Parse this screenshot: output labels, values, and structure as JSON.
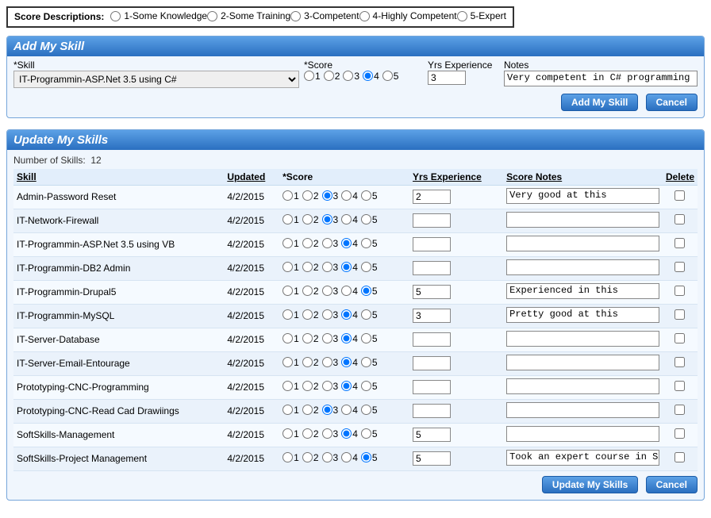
{
  "score_descriptions": {
    "label": "Score Descriptions:",
    "options": [
      "1-Some Knowledge",
      "2-Some Training",
      "3-Competent",
      "4-Highly Competent",
      "5-Expert"
    ]
  },
  "add_panel": {
    "title": "Add My Skill",
    "skill_label": "Skill",
    "score_label": "Score",
    "yrs_label": "Yrs Experience",
    "notes_label": "Notes",
    "skill_value": "IT-Programmin-ASP.Net 3.5 using C#",
    "score_selected": 4,
    "yrs_value": "3",
    "notes_value": "Very competent in C# programming",
    "add_btn": "Add My Skill",
    "cancel_btn": "Cancel"
  },
  "update_panel": {
    "title": "Update My Skills",
    "count_label": "Number of Skills:",
    "count_value": "12",
    "headers": {
      "skill": "Skill",
      "updated": "Updated",
      "score": "*Score",
      "yrs": "Yrs Experience",
      "notes": "Score Notes",
      "delete": "Delete"
    },
    "rows": [
      {
        "skill": "Admin-Password Reset",
        "updated": "4/2/2015",
        "score": 3,
        "yrs": "2",
        "notes": "Very good at this"
      },
      {
        "skill": "IT-Network-Firewall",
        "updated": "4/2/2015",
        "score": 3,
        "yrs": "",
        "notes": ""
      },
      {
        "skill": "IT-Programmin-ASP.Net 3.5 using VB",
        "updated": "4/2/2015",
        "score": 4,
        "yrs": "",
        "notes": ""
      },
      {
        "skill": "IT-Programmin-DB2 Admin",
        "updated": "4/2/2015",
        "score": 4,
        "yrs": "",
        "notes": ""
      },
      {
        "skill": "IT-Programmin-Drupal5",
        "updated": "4/2/2015",
        "score": 5,
        "yrs": "5",
        "notes": "Experienced in this"
      },
      {
        "skill": "IT-Programmin-MySQL",
        "updated": "4/2/2015",
        "score": 4,
        "yrs": "3",
        "notes": "Pretty good at this"
      },
      {
        "skill": "IT-Server-Database",
        "updated": "4/2/2015",
        "score": 4,
        "yrs": "",
        "notes": ""
      },
      {
        "skill": "IT-Server-Email-Entourage",
        "updated": "4/2/2015",
        "score": 4,
        "yrs": "",
        "notes": ""
      },
      {
        "skill": "Prototyping-CNC-Programming",
        "updated": "4/2/2015",
        "score": 4,
        "yrs": "",
        "notes": ""
      },
      {
        "skill": "Prototyping-CNC-Read Cad Drawiings",
        "updated": "4/2/2015",
        "score": 3,
        "yrs": "",
        "notes": ""
      },
      {
        "skill": "SoftSkills-Management",
        "updated": "4/2/2015",
        "score": 4,
        "yrs": "5",
        "notes": ""
      },
      {
        "skill": "SoftSkills-Project Management",
        "updated": "4/2/2015",
        "score": 5,
        "yrs": "5",
        "notes": "Took an expert course in S-P Management"
      }
    ],
    "update_btn": "Update My Skills",
    "cancel_btn": "Cancel"
  }
}
